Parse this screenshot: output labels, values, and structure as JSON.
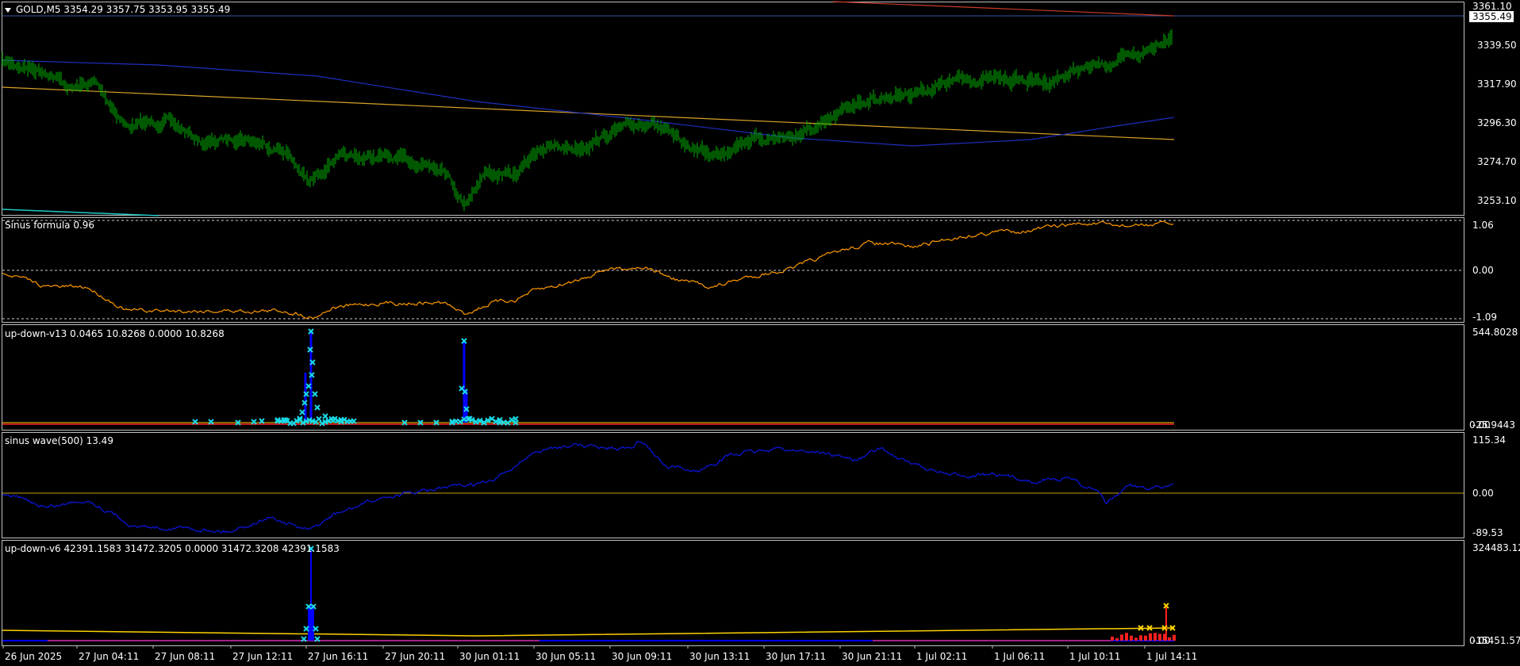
{
  "colors": {
    "background": "#000000",
    "border": "#c0c0c0",
    "price_candles": "#00b000",
    "ma_blue": "#1f2fbf",
    "ma_orange": "#d9a32a",
    "ma_red": "#c83c2a",
    "ma_cyan": "#1fc8c8",
    "bid_line": "#3a55a0",
    "sinus_line": "#ff9900",
    "level_dotted": "#ffffff",
    "updown_blue": "#0000ff",
    "updown_cyan": "#19d9e6",
    "updown_red": "#ff2020",
    "updown_yellow": "#ffd200",
    "sinus_wave_line": "#0a14c8",
    "zero_line": "#c8a000"
  },
  "main_panel": {
    "title": "GOLD,M5  3354.29 3357.75 3353.95 3355.49",
    "collapse_icon": "triangle-down-icon",
    "current_price": "3355.49",
    "price_labels": [
      "3361.10",
      "3339.50",
      "3317.90",
      "3296.30",
      "3274.70",
      "3253.10"
    ]
  },
  "sinus_formula": {
    "title": "Sinus formula 0.96",
    "levels": [
      "1.06",
      "0.00",
      "-1.09"
    ]
  },
  "updown_v13": {
    "title": "up-down-v13 0.0465 10.8268 0.0000 10.8268",
    "levels": [
      "544.8028",
      "-25.9443",
      "0.00"
    ]
  },
  "sinus_wave": {
    "title": "sinus wave(500) 13.49",
    "levels": [
      "115.34",
      "0.00",
      "-89.53"
    ]
  },
  "updown_v6": {
    "title": "up-down-v6 42391.1583 31472.3205 0.0000 31472.3208 42391.1583",
    "levels": [
      "324483.12",
      "-15451.577",
      "0.00"
    ]
  },
  "time_axis": [
    "26 Jun 2025",
    "27 Jun 04:11",
    "27 Jun 08:11",
    "27 Jun 12:11",
    "27 Jun 16:11",
    "27 Jun 20:11",
    "30 Jun 01:11",
    "30 Jun 05:11",
    "30 Jun 09:11",
    "30 Jun 13:11",
    "30 Jun 17:11",
    "30 Jun 21:11",
    "1 Jul 02:11",
    "1 Jul 06:11",
    "1 Jul 10:11",
    "1 Jul 14:11"
  ]
}
